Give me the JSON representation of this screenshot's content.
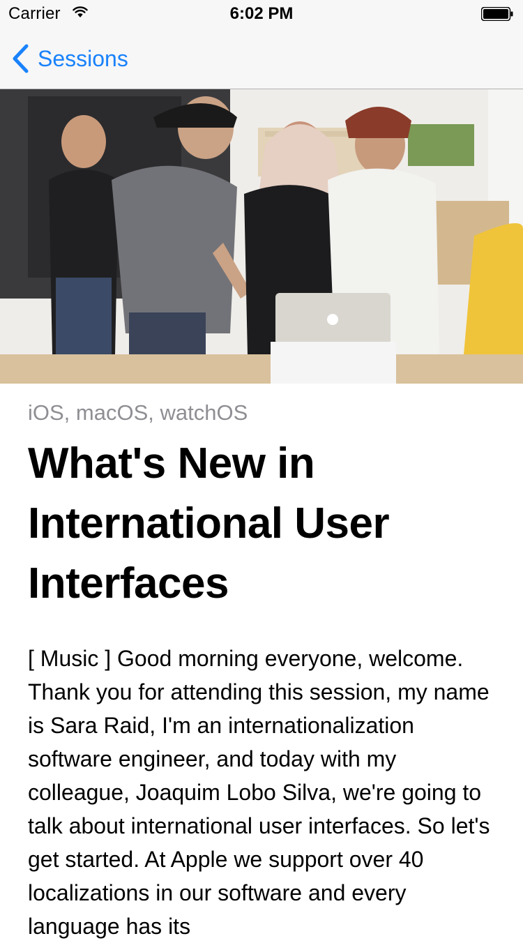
{
  "status_bar": {
    "carrier": "Carrier",
    "time": "6:02 PM"
  },
  "nav": {
    "back_label": "Sessions"
  },
  "hero": {
    "icon": "photo-apple-store-session"
  },
  "session": {
    "platforms": "iOS, macOS, watchOS",
    "title": "What's New in International User Interfaces",
    "transcript": "[ Music ] Good morning everyone, welcome. Thank you for attending this session, my name is Sara Raid, I'm an internationalization software engineer, and today with my colleague, Joaquim Lobo Silva, we're going to talk about international user interfaces. So let's get started. At Apple we support over 40 localizations in our software and every language has its"
  },
  "colors": {
    "accent": "#1a82fb",
    "secondary_text": "#8e8e93",
    "bar_background": "#f7f7f7"
  }
}
